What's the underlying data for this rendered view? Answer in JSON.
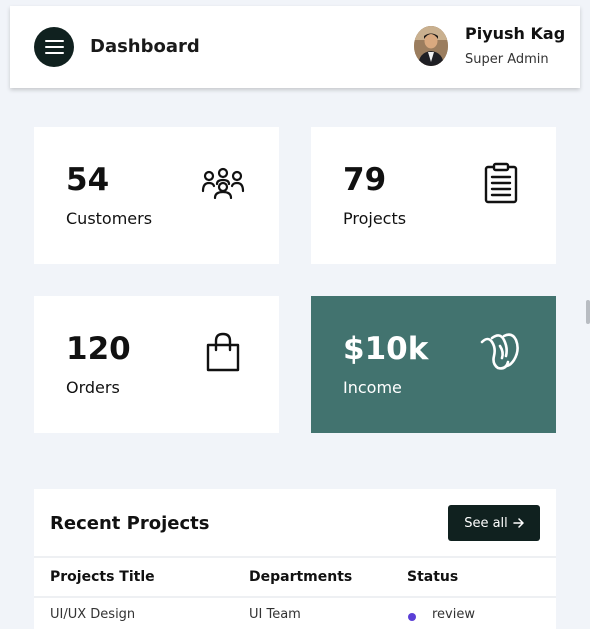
{
  "header": {
    "title": "Dashboard",
    "user": {
      "name": "Piyush Kag",
      "role": "Super Admin"
    }
  },
  "stats": [
    {
      "value": "54",
      "label": "Customers",
      "icon": "customers-icon"
    },
    {
      "value": "79",
      "label": "Projects",
      "icon": "clipboard-icon"
    },
    {
      "value": "120",
      "label": "Orders",
      "icon": "shopping-bag-icon"
    },
    {
      "value": "$10k",
      "label": "Income",
      "icon": "money-icon",
      "highlighted": true
    }
  ],
  "recent_projects": {
    "title": "Recent Projects",
    "see_all": "See all",
    "columns": [
      "Projects Title",
      "Departments",
      "Status"
    ],
    "rows": [
      {
        "title": "UI/UX Design",
        "department": "UI Team",
        "status": "review"
      }
    ]
  },
  "colors": {
    "accent": "#42736f",
    "dark": "#10211f",
    "background": "#f1f4f9",
    "status_review": "#5b3fd6"
  }
}
